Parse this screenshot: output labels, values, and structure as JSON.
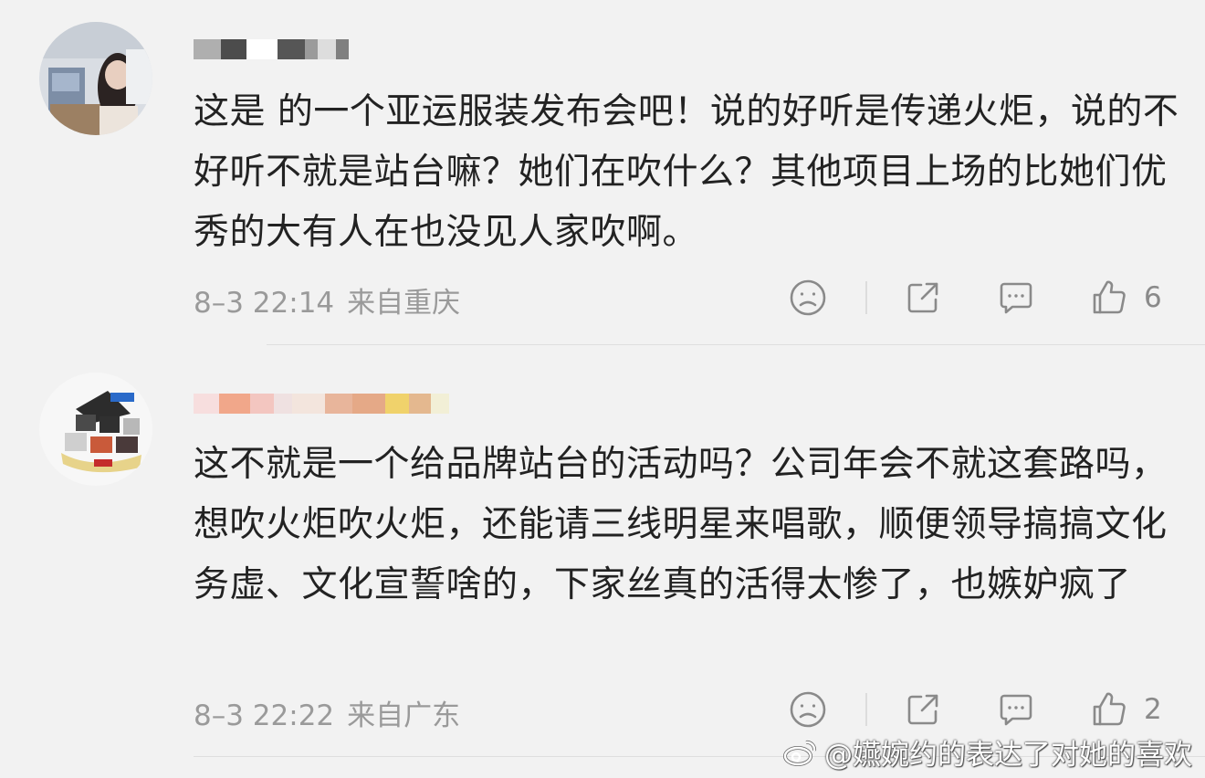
{
  "comments": [
    {
      "text": "这是  的一个亚运服装发布会吧！说的好听是传递火炬，说的不好听不就是站台嘛？她们在吹什么？其他项目上场的比她们优秀的大有人在也没见人家吹啊。",
      "time": "8–3 22:14",
      "location": "来自重庆",
      "likes": "6"
    },
    {
      "text": "这不就是一个给品牌站台的活动吗？公司年会不就这套路吗，想吹火炬吹火炬，还能请三线明星来唱歌，顺便领导搞搞文化务虚、文化宣誓啥的，下家丝真的活得太惨了，也嫉妒疯了",
      "time": "8–3 22:22",
      "location": "来自广东",
      "likes": "2"
    }
  ],
  "icons": {
    "dislike": "sad-face-icon",
    "share": "share-icon",
    "reply": "comment-icon",
    "like": "thumbs-up-icon"
  },
  "watermark": {
    "text": "@嬿婉约的表达了对她的喜欢"
  },
  "colors": {
    "background": "#f2f2f2",
    "text": "#222222",
    "meta": "#9a9a9a"
  }
}
